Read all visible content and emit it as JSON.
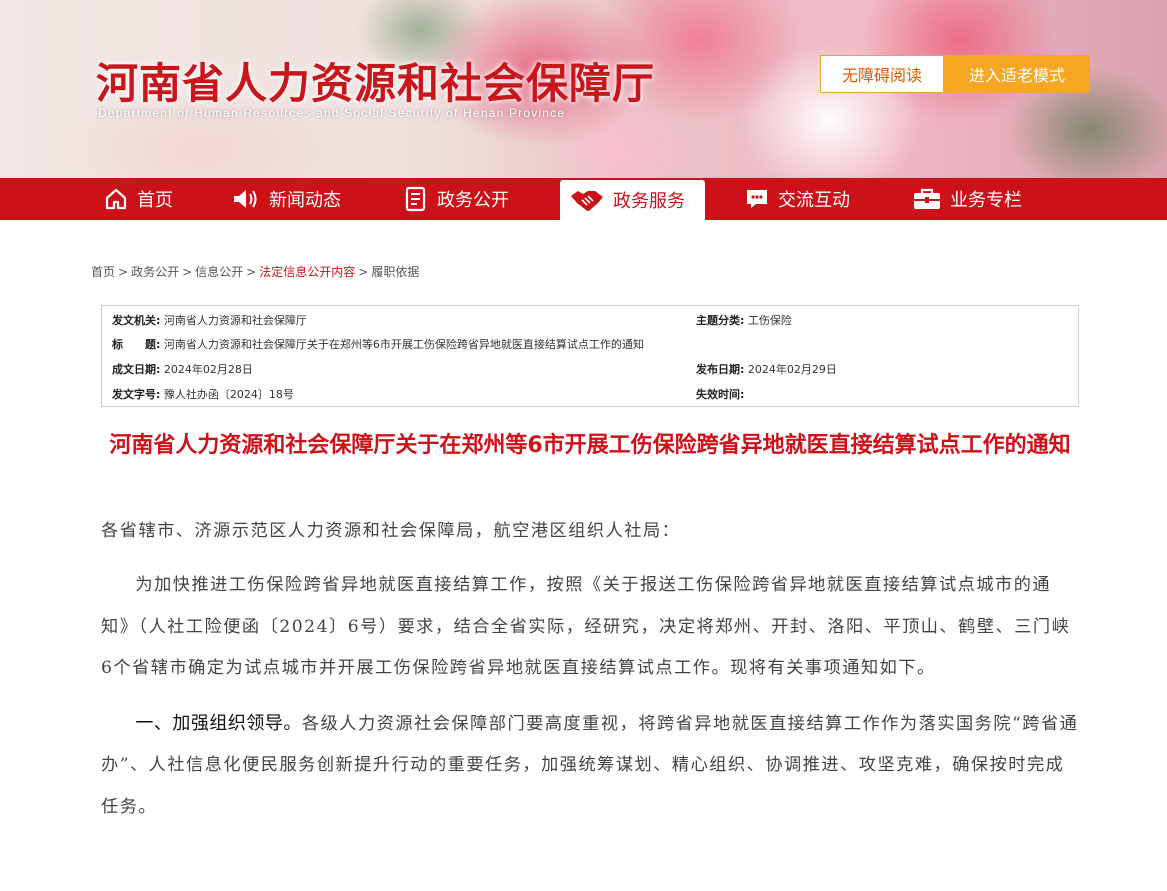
{
  "header": {
    "site_title": "河南省人力资源和社会保障厅",
    "site_subtitle": "Department of Human Resources and Social Security of Henan Province",
    "accessibility_label": "无障碍阅读",
    "elder_mode_label": "进入适老模式"
  },
  "nav": {
    "items": [
      {
        "label": "首页",
        "icon": "home-icon"
      },
      {
        "label": "新闻动态",
        "icon": "speaker-icon"
      },
      {
        "label": "政务公开",
        "icon": "document-icon"
      },
      {
        "label": "政务服务",
        "icon": "handshake-icon",
        "active": true
      },
      {
        "label": "交流互动",
        "icon": "chat-icon"
      },
      {
        "label": "业务专栏",
        "icon": "briefcase-icon"
      }
    ],
    "active_color": "#cc1118"
  },
  "breadcrumb": {
    "items": [
      "首页",
      "政务公开",
      "信息公开",
      "法定信息公开内容",
      "履职依据"
    ],
    "separator": ">"
  },
  "meta": {
    "issuer_label": "发文机关:",
    "issuer": "河南省人力资源和社会保障厅",
    "topic_label": "主题分类:",
    "topic": "工伤保险",
    "title_label": "标　　题:",
    "title": "河南省人力资源和社会保障厅关于在郑州等6市开展工伤保险跨省异地就医直接结算试点工作的通知",
    "date_label": "成文日期:",
    "date": "2024年02月28日",
    "publish_label": "发布日期:",
    "publish": "2024年02月29日",
    "doc_no_label": "发文字号:",
    "doc_no": "豫人社办函〔2024〕18号",
    "effective_label": "失效时间:",
    "effective": ""
  },
  "article": {
    "title": "河南省人力资源和社会保障厅关于在郑州等6市开展工伤保险跨省异地就医直接结算试点工作的通知",
    "salutation": "各省辖市、济源示范区人力资源和社会保障局，航空港区组织人社局：",
    "paragraph_1": "为加快推进工伤保险跨省异地就医直接结算工作，按照《关于报送工伤保险跨省异地就医直接结算试点城市的通知》（人社工险便函〔2024〕6号）要求，结合全省实际，经研究，决定将郑州、开封、洛阳、平顶山、鹤壁、三门峡6个省辖市确定为试点城市并开展工伤保险跨省异地就医直接结算试点工作。现将有关事项通知如下。",
    "section_1_heading": "一、加强组织领导。",
    "section_1_text": "各级人力资源社会保障部门要高度重视，将跨省异地就医直接结算工作作为落实国务院“跨省通办”、人社信息化便民服务创新提升行动的重要任务，加强统筹谋划、精心组织、协调推进、攻坚克难，确保按时完成任务。"
  }
}
